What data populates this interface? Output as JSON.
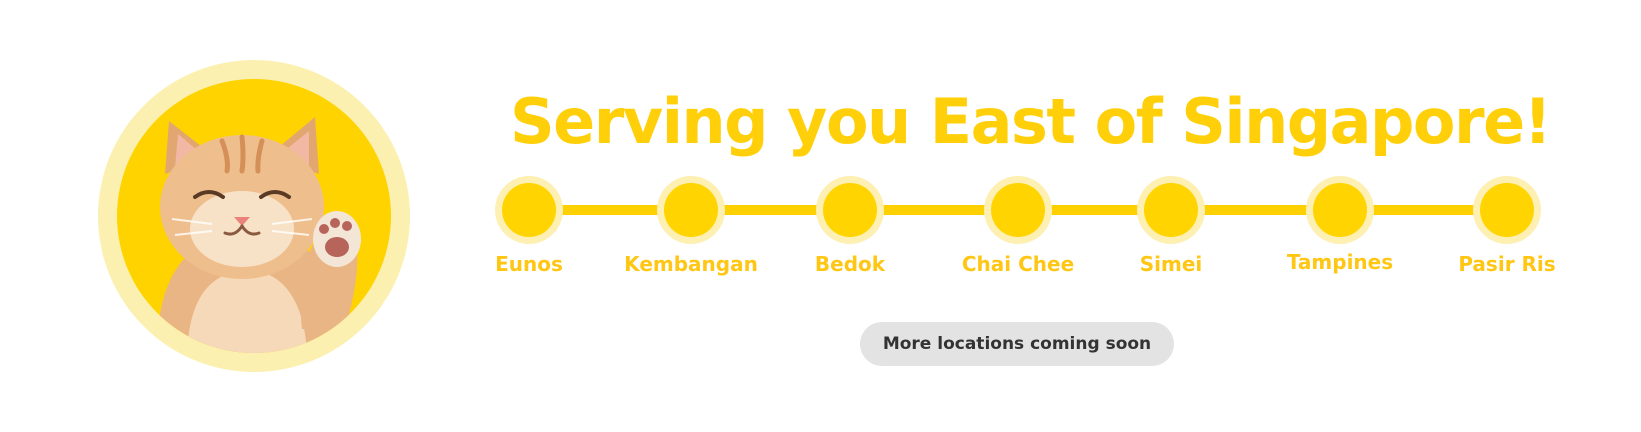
{
  "banner": {
    "headline": "Serving you East of Singapore!",
    "image": {
      "subject": "smiling ginger kitten waving paw",
      "ring_color": "#fbf0b0",
      "background_color": "#ffd300"
    },
    "route": {
      "line_color": "#ffd000",
      "stops": [
        {
          "label": "Eunos"
        },
        {
          "label": "Kembangan"
        },
        {
          "label": "Bedok"
        },
        {
          "label": "Chai Chee"
        },
        {
          "label": "Simei"
        },
        {
          "label": "Tampines"
        },
        {
          "label": "Pasir Ris"
        }
      ]
    },
    "more_locations": "More locations coming soon",
    "accent_color": "#ffd00a"
  }
}
